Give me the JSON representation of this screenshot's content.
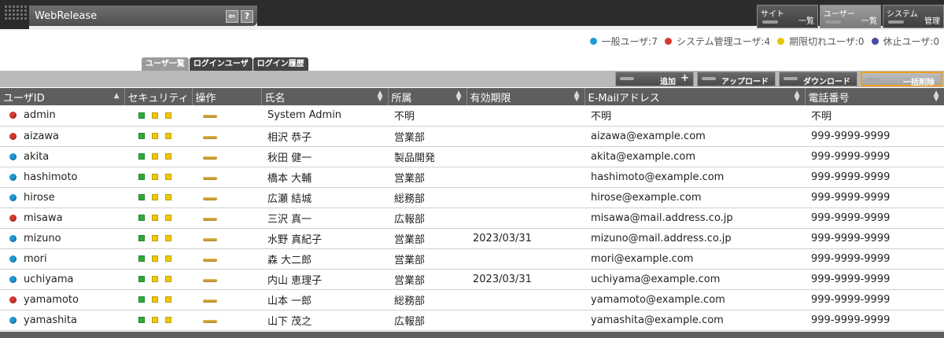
{
  "app": {
    "title": "WebRelease"
  },
  "title_icons": [
    {
      "icon": "back-icon",
      "glyph": "⇐"
    },
    {
      "icon": "help-icon",
      "glyph": "?"
    }
  ],
  "menu": [
    {
      "line1": "サイト",
      "line2": "一覧",
      "active": false
    },
    {
      "line1": "ユーザー",
      "line2": "一覧",
      "active": true
    },
    {
      "line1": "システム",
      "line2": "管理",
      "active": false
    }
  ],
  "stats": [
    {
      "label": "一般ユーザ:7",
      "color": "#1e9ad8"
    },
    {
      "label": "システム管理ユーザ:4",
      "color": "#d83a2e"
    },
    {
      "label": "期限切れユーザ:0",
      "color": "#e6c400"
    },
    {
      "label": "休止ユーザ:0",
      "color": "#4a4aa0"
    }
  ],
  "tabs": [
    {
      "label": "ユーザ一覧",
      "active": true
    },
    {
      "label": "ログインユーザ",
      "active": false
    },
    {
      "label": "ログイン履歴",
      "active": false
    }
  ],
  "actions": [
    {
      "label": "追加",
      "extra": "+"
    },
    {
      "label": "アップロード"
    },
    {
      "label": "ダウンロード"
    },
    {
      "label": "一括削除",
      "highlight": true
    }
  ],
  "columns": [
    {
      "label": "ユーザID",
      "sort": "asc"
    },
    {
      "label": "セキュリティ",
      "sort": ""
    },
    {
      "label": "操作",
      "sort": ""
    },
    {
      "label": "氏名",
      "sort": "both"
    },
    {
      "label": "所属",
      "sort": "both"
    },
    {
      "label": "有効期限",
      "sort": "both"
    },
    {
      "label": "E-Mailアドレス",
      "sort": "both"
    },
    {
      "label": "電話番号",
      "sort": "both"
    }
  ],
  "colors": {
    "admin": "#d83a2e",
    "user": "#1e9ad8",
    "green": "#2eaa3a",
    "yellow": "#f0c800"
  },
  "rows": [
    {
      "id": "admin",
      "type": "admin",
      "name": "System Admin",
      "dept": "不明",
      "expiry": "",
      "email": "不明",
      "phone": "不明"
    },
    {
      "id": "aizawa",
      "type": "admin",
      "name": "相沢 恭子",
      "dept": "営業部",
      "expiry": "",
      "email": "aizawa@example.com",
      "phone": "999-9999-9999"
    },
    {
      "id": "akita",
      "type": "user",
      "name": "秋田 健一",
      "dept": "製品開発",
      "expiry": "",
      "email": "akita@example.com",
      "phone": "999-9999-9999"
    },
    {
      "id": "hashimoto",
      "type": "user",
      "name": "橋本 大輔",
      "dept": "営業部",
      "expiry": "",
      "email": "hashimoto@example.com",
      "phone": "999-9999-9999"
    },
    {
      "id": "hirose",
      "type": "user",
      "name": "広瀬 結城",
      "dept": "総務部",
      "expiry": "",
      "email": "hirose@example.com",
      "phone": "999-9999-9999"
    },
    {
      "id": "misawa",
      "type": "admin",
      "name": "三沢 真一",
      "dept": "広報部",
      "expiry": "",
      "email": "misawa@mail.address.co.jp",
      "phone": "999-9999-9999"
    },
    {
      "id": "mizuno",
      "type": "user",
      "name": "水野 真紀子",
      "dept": "営業部",
      "expiry": "2023/03/31",
      "email": "mizuno@mail.address.co.jp",
      "phone": "999-9999-9999"
    },
    {
      "id": "mori",
      "type": "user",
      "name": "森 大二郎",
      "dept": "営業部",
      "expiry": "",
      "email": "mori@example.com",
      "phone": "999-9999-9999"
    },
    {
      "id": "uchiyama",
      "type": "user",
      "name": "内山 恵理子",
      "dept": "営業部",
      "expiry": "2023/03/31",
      "email": "uchiyama@example.com",
      "phone": "999-9999-9999"
    },
    {
      "id": "yamamoto",
      "type": "admin",
      "name": "山本 一郎",
      "dept": "総務部",
      "expiry": "",
      "email": "yamamoto@example.com",
      "phone": "999-9999-9999"
    },
    {
      "id": "yamashita",
      "type": "user",
      "name": "山下 茂之",
      "dept": "広報部",
      "expiry": "",
      "email": "yamashita@example.com",
      "phone": "999-9999-9999"
    }
  ]
}
